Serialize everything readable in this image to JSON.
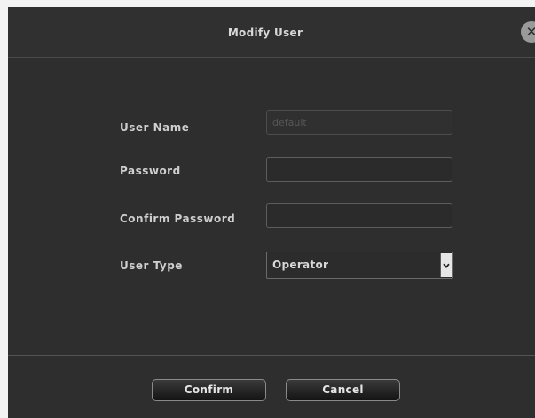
{
  "dialog": {
    "title": "Modify User",
    "close_icon": "close-icon"
  },
  "form": {
    "user_name": {
      "label": "User Name",
      "value": "default",
      "disabled": true
    },
    "password": {
      "label": "Password",
      "value": ""
    },
    "confirm_password": {
      "label": "Confirm Password",
      "value": ""
    },
    "user_type": {
      "label": "User Type",
      "value": "Operator",
      "arrow_icon": "chevron-down-icon"
    }
  },
  "buttons": {
    "confirm": "Confirm",
    "cancel": "Cancel"
  }
}
